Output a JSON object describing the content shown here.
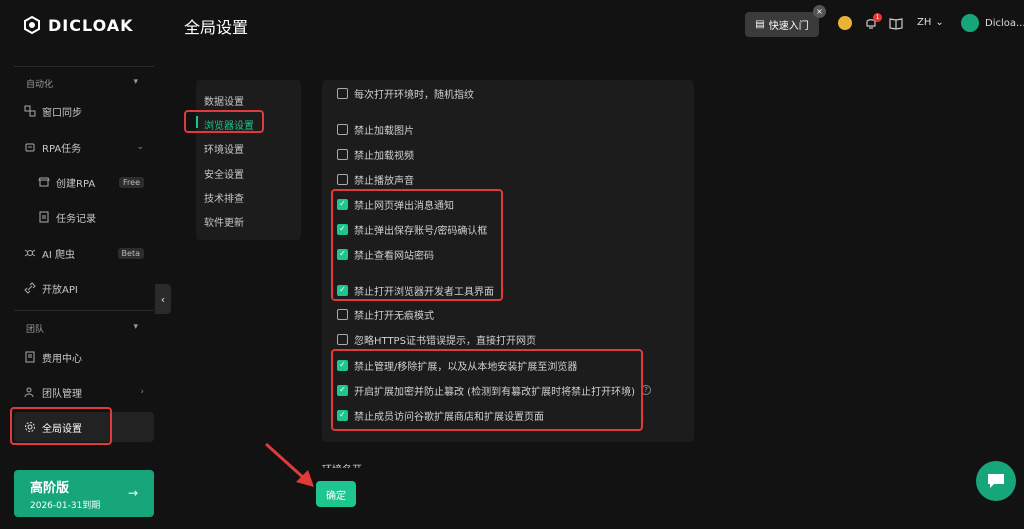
{
  "app": {
    "logo_text": "DICLOAK",
    "page_title": "全局设置"
  },
  "header": {
    "quick_start": "快速入门",
    "notification_count": "1",
    "language": "ZH",
    "username": "Dicloa..."
  },
  "sidebar": {
    "section_automation": "自动化",
    "section_team": "团队",
    "items": [
      {
        "label": "窗口同步"
      },
      {
        "label": "RPA任务"
      },
      {
        "label": "创建RPA",
        "badge": "Free"
      },
      {
        "label": "任务记录"
      },
      {
        "label": "AI 爬虫",
        "badge": "Beta"
      },
      {
        "label": "开放API"
      },
      {
        "label": "费用中心"
      },
      {
        "label": "团队管理"
      },
      {
        "label": "全局设置"
      }
    ],
    "plan": {
      "name": "高阶版",
      "expiry": "2026-01-31到期"
    }
  },
  "settings_nav": [
    "数据设置",
    "浏览器设置",
    "环境设置",
    "安全设置",
    "技术排查",
    "软件更新"
  ],
  "options": [
    {
      "label": "每次打开环境时，随机指纹",
      "checked": false
    },
    {
      "label": "禁止加载图片",
      "checked": false
    },
    {
      "label": "禁止加载视频",
      "checked": false
    },
    {
      "label": "禁止播放声音",
      "checked": false
    },
    {
      "label": "禁止网页弹出消息通知",
      "checked": true
    },
    {
      "label": "禁止弹出保存账号/密码确认框",
      "checked": true
    },
    {
      "label": "禁止查看网站密码",
      "checked": true
    },
    {
      "label": "禁止打开浏览器开发者工具界面",
      "checked": true
    },
    {
      "label": "禁止打开无痕模式",
      "checked": false
    },
    {
      "label": "忽略HTTPS证书错误提示，直接打开网页",
      "checked": false
    },
    {
      "label": "禁止管理/移除扩展，以及从本地安装扩展至浏览器",
      "checked": true
    },
    {
      "label": "开启扩展加密并防止篡改 (检测到有篡改扩展时将禁止打开环境)",
      "checked": true
    },
    {
      "label": "禁止成员访问谷歌扩展商店和扩展设置页面",
      "checked": true
    }
  ],
  "footer": {
    "env_name_label": "环境名开",
    "confirm": "确定"
  },
  "colors": {
    "accent": "#1ec58f",
    "highlight": "#e03a3a",
    "plan_card": "#17a67a"
  }
}
